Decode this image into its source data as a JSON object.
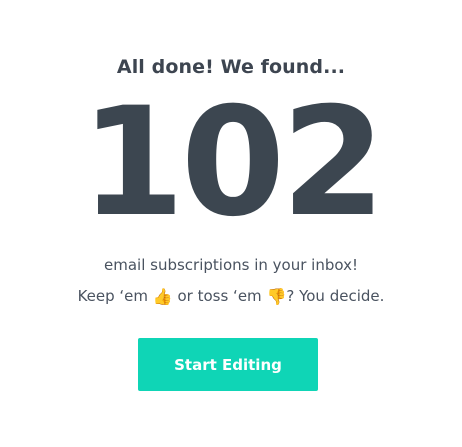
{
  "headline": "All done! We found...",
  "count": "102",
  "message": {
    "line1": "email subscriptions in your inbox!",
    "keep_prefix": "Keep ‘em ",
    "thumbs_up": "👍",
    "toss_text": " or toss ‘em ",
    "thumbs_down": "👎",
    "decide_suffix": "? You decide."
  },
  "cta": {
    "label": "Start Editing",
    "color": "#0fd5b6"
  },
  "icons": {
    "thumbs_up": "thumbs-up-icon",
    "thumbs_down": "thumbs-down-icon"
  }
}
